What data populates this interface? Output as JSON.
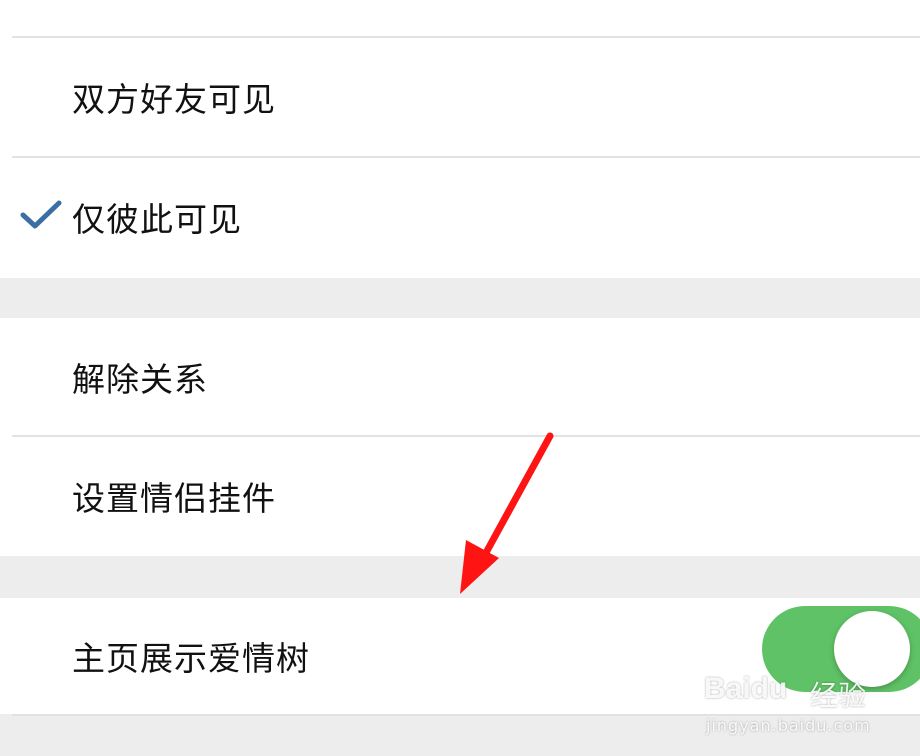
{
  "list": {
    "items": [
      {
        "label": "双方好友可见",
        "checked": false
      },
      {
        "label": "仅彼此可见",
        "checked": true
      },
      {
        "label": "解除关系"
      },
      {
        "label": "设置情侣挂件"
      },
      {
        "label": "主页展示爱情树",
        "toggle": "on"
      }
    ]
  },
  "colors": {
    "check": "#3a6ea5",
    "toggle_on": "#5fc266",
    "arrow": "#ff1414"
  },
  "watermark": {
    "logo": "Baidu",
    "brand": "经验",
    "url": "jingyan.baidu.com"
  }
}
